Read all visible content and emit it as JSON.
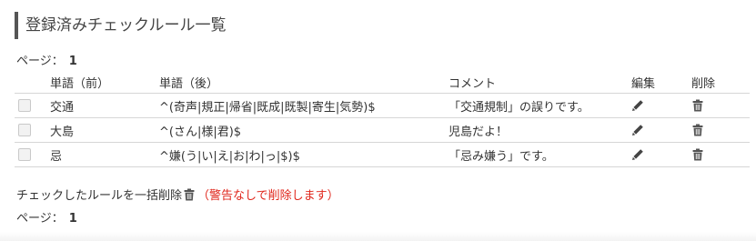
{
  "page_title": "登録済みチェックルール一覧",
  "pager": {
    "label": "ページ：",
    "current": "1"
  },
  "table": {
    "headers": {
      "before": "単語（前）",
      "after": "単語（後）",
      "comment": "コメント",
      "edit": "編集",
      "delete": "削除"
    },
    "rows": [
      {
        "before": "交通",
        "after": "^(奇声|規正|帰省|既成|既製|寄生|気勢)$",
        "comment": "「交通規制」の誤りです。"
      },
      {
        "before": "大島",
        "after": "^(さん|様|君)$",
        "comment": "児島だよ！"
      },
      {
        "before": "忌",
        "after": "^嫌(う|い|え|お|わ|っ|$)$",
        "comment": "「忌み嫌う」です。"
      }
    ]
  },
  "bulk_delete": {
    "label": "チェックしたルールを一括削除",
    "warning": "（警告なしで削除します）"
  },
  "icons": {
    "edit": "pencil-icon",
    "delete": "trash-icon"
  },
  "colors": {
    "warning": "#e0261b",
    "title_bar": "#555555"
  }
}
